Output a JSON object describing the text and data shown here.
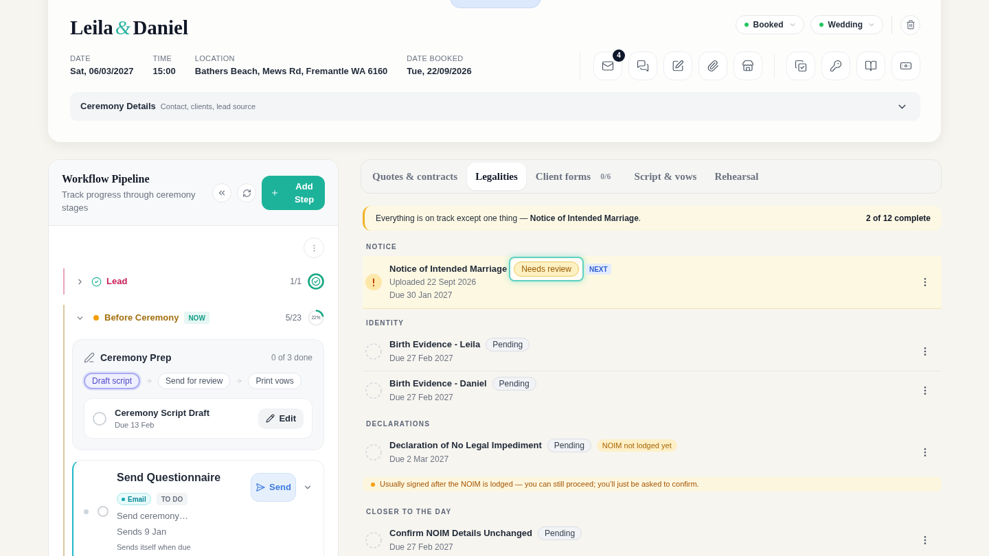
{
  "header": {
    "names": [
      "Leila",
      "Daniel"
    ],
    "joiner": "&",
    "status_menus": [
      {
        "label": "Booked"
      },
      {
        "label": "Wedding"
      }
    ],
    "details": [
      {
        "label": "DATE",
        "value": "Sat, 06/03/2027"
      },
      {
        "label": "TIME",
        "value": "15:00"
      },
      {
        "label": "LOCATION",
        "value": "Bathers Beach, Mews Rd, Fremantle WA 6160"
      },
      {
        "label": "DATE BOOKED",
        "value": "Tue, 22/09/2026"
      }
    ],
    "unread_count": "4",
    "ceremony_details": {
      "title": "Ceremony Details",
      "summary": "Contact, clients, lead source",
      "expanded": false
    }
  },
  "workflow": {
    "title": "Workflow Pipeline",
    "subtitle": "Track progress through ceremony stages",
    "add_label": "Add Step",
    "stages": [
      {
        "name": "Lead",
        "color": "#c81e5a",
        "kind": "done",
        "expanded": false,
        "count": "1/1",
        "level": 1
      },
      {
        "name": "Before Ceremony",
        "color": "#a3700f",
        "kind": "active",
        "expanded": true,
        "badge": "NOW",
        "count": "5/23",
        "level": 0.22,
        "percent": "22%",
        "cards": [
          {
            "kind": "group",
            "title": "Ceremony Prep",
            "done_count": "0 of 3 done",
            "steps": [
              {
                "label": "Draft script",
                "selected": true
              },
              {
                "label": "Send for review",
                "selected": false
              },
              {
                "label": "Print vows",
                "selected": false
              }
            ],
            "tasks": [
              {
                "title": "Ceremony Script Draft",
                "due": "Due 13 Feb",
                "checked": false,
                "action": "Edit"
              }
            ]
          },
          {
            "kind": "automation",
            "title": "Send Questionnaire",
            "channel": "Email",
            "status": "TO DO",
            "preview": "Send ceremony…",
            "schedule": "Sends 9 Jan",
            "note": "Sends itself when due",
            "checked": false,
            "action": "Send",
            "expanded": false
          }
        ]
      }
    ]
  },
  "legalities": {
    "tabs": [
      {
        "label": "Quotes & contracts",
        "selected": false
      },
      {
        "label": "Legalities",
        "selected": true
      },
      {
        "label": "Client forms",
        "count": "0/6",
        "selected": false
      },
      {
        "label": "Script & vows",
        "selected": false
      },
      {
        "label": "Rehearsal",
        "selected": false
      }
    ],
    "summary": {
      "text": "Everything is on track except one thing — **Notice of Intended Marriage**.",
      "progress": "2 of 12 complete"
    },
    "sections": [
      {
        "title": "NOTICE",
        "items": [
          {
            "kind": "attention",
            "title": "Notice of Intended Marriage",
            "status": "Needs review",
            "highlighted": true,
            "tag": "NEXT",
            "details": [
              "Uploaded 22 Sept 2026",
              "Due 30 Jan 2027"
            ]
          }
        ]
      },
      {
        "title": "IDENTITY",
        "items": [
          {
            "kind": "pending",
            "title": "Birth Evidence - Leila",
            "status": "Pending",
            "highlighted": false,
            "details": [
              "Due 27 Feb 2027"
            ]
          },
          {
            "kind": "pending",
            "title": "Birth Evidence - Daniel",
            "status": "Pending",
            "highlighted": false,
            "details": [
              "Due 27 Feb 2027"
            ]
          }
        ]
      },
      {
        "title": "DECLARATIONS",
        "items": [
          {
            "kind": "pending",
            "title": "Declaration of No Legal Impediment",
            "status": "Pending",
            "highlighted": false,
            "blocker": "NOIM not lodged yet",
            "details": [
              "Due 2 Mar 2027"
            ],
            "note": "Usually signed after the NOIM is lodged — you can still proceed; you’ll just be asked to confirm."
          }
        ]
      },
      {
        "title": "CLOSER TO THE DAY",
        "items": [
          {
            "kind": "pending",
            "title": "Confirm NOIM Details Unchanged",
            "status": "Pending",
            "highlighted": false,
            "details": [
              "Due 27 Feb 2027"
            ]
          }
        ]
      }
    ]
  }
}
